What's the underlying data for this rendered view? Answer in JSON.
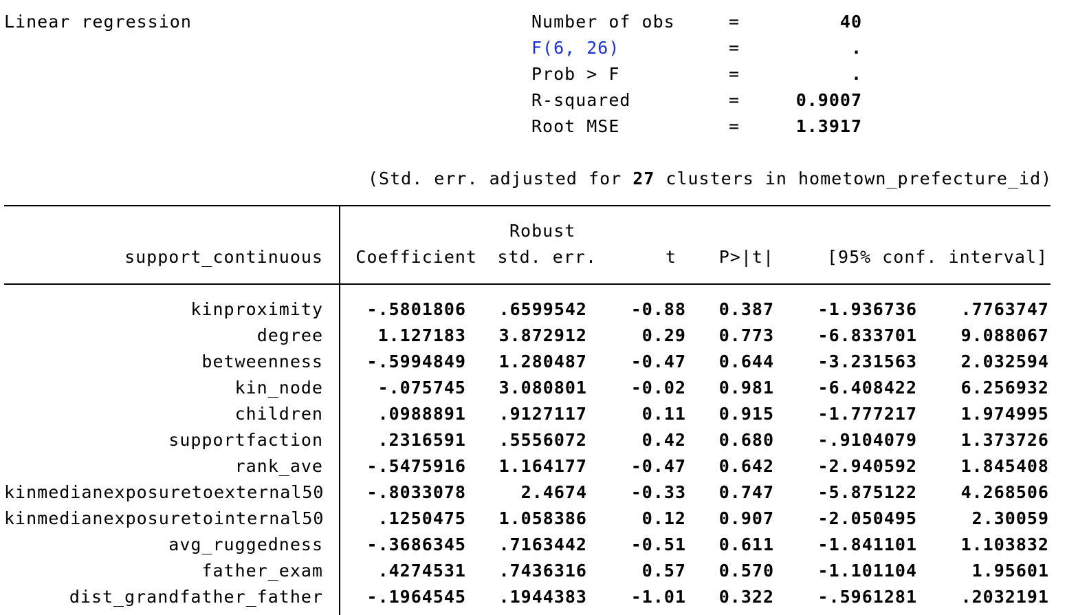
{
  "title": "Linear regression",
  "stats": [
    {
      "label": "Number of obs",
      "eq": "=",
      "value": "40",
      "link": false
    },
    {
      "label": "F(6, 26)",
      "eq": "=",
      "value": ".",
      "link": true
    },
    {
      "label": "Prob > F",
      "eq": "=",
      "value": ".",
      "link": false
    },
    {
      "label": "R-squared",
      "eq": "=",
      "value": "0.9007",
      "link": false
    },
    {
      "label": "Root MSE",
      "eq": "=",
      "value": "1.3917",
      "link": false
    }
  ],
  "cluster_note": {
    "prefix": "(Std. err. adjusted for ",
    "count": "27",
    "suffix": " clusters in hometown_prefecture_id)"
  },
  "header": {
    "depvar": "support_continuous",
    "robust": "Robust",
    "coef": "Coefficient",
    "se": "std. err.",
    "t": "t",
    "p": "P>|t|",
    "ci": "[95% conf. interval]"
  },
  "rows": [
    [
      "kinproximity",
      "-.5801806",
      ".6599542",
      "-0.88",
      "0.387",
      "-1.936736",
      ".7763747"
    ],
    [
      "degree",
      "1.127183",
      "3.872912",
      "0.29",
      "0.773",
      "-6.833701",
      "9.088067"
    ],
    [
      "betweenness",
      "-.5994849",
      "1.280487",
      "-0.47",
      "0.644",
      "-3.231563",
      "2.032594"
    ],
    [
      "kin_node",
      "-.075745",
      "3.080801",
      "-0.02",
      "0.981",
      "-6.408422",
      "6.256932"
    ],
    [
      "children",
      ".0988891",
      ".9127117",
      "0.11",
      "0.915",
      "-1.777217",
      "1.974995"
    ],
    [
      "supportfaction",
      ".2316591",
      ".5556072",
      "0.42",
      "0.680",
      "-.9104079",
      "1.373726"
    ],
    [
      "rank_ave",
      "-.5475916",
      "1.164177",
      "-0.47",
      "0.642",
      "-2.940592",
      "1.845408"
    ],
    [
      "kinmedianexposuretoexternal50",
      "-.8033078",
      "2.4674",
      "-0.33",
      "0.747",
      "-5.875122",
      "4.268506"
    ],
    [
      "kinmedianexposuretointernal50",
      ".1250475",
      "1.058386",
      "0.12",
      "0.907",
      "-2.050495",
      "2.30059"
    ],
    [
      "avg_ruggedness",
      "-.3686345",
      ".7163442",
      "-0.51",
      "0.611",
      "-1.841101",
      "1.103832"
    ],
    [
      "father_exam",
      ".4274531",
      ".7436316",
      "0.57",
      "0.570",
      "-1.101104",
      "1.95601"
    ],
    [
      "dist_grandfather_father",
      "-.1964545",
      ".1944383",
      "-1.01",
      "0.322",
      "-.5961281",
      ".2032191"
    ]
  ]
}
